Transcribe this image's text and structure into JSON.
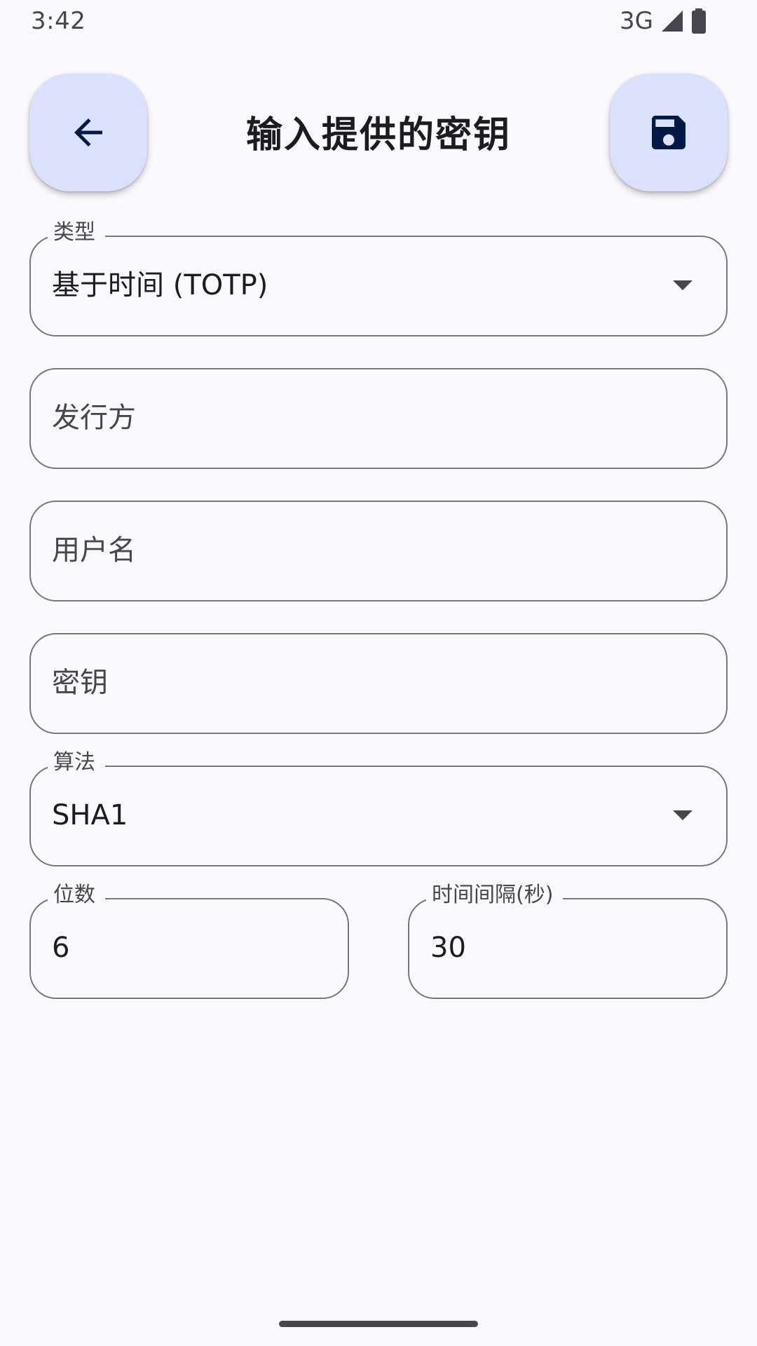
{
  "status_bar": {
    "time": "3:42",
    "network": "3G",
    "icons": [
      "cell-signal-icon",
      "battery-icon"
    ]
  },
  "header": {
    "title": "输入提供的密钥",
    "back_icon": "arrow-back-icon",
    "save_icon": "floppy-save-icon",
    "button_bg": "#dbe1fd",
    "icon_color": "#001945"
  },
  "form": {
    "type": {
      "label": "类型",
      "value": "基于时间 (TOTP)"
    },
    "issuer": {
      "placeholder": "发行方",
      "value": ""
    },
    "username": {
      "placeholder": "用户名",
      "value": ""
    },
    "secret": {
      "placeholder": "密钥",
      "value": ""
    },
    "algorithm": {
      "label": "算法",
      "value": "SHA1"
    },
    "digits": {
      "label": "位数",
      "value": "6"
    },
    "period": {
      "label": "时间间隔(秒)",
      "value": "30"
    }
  }
}
